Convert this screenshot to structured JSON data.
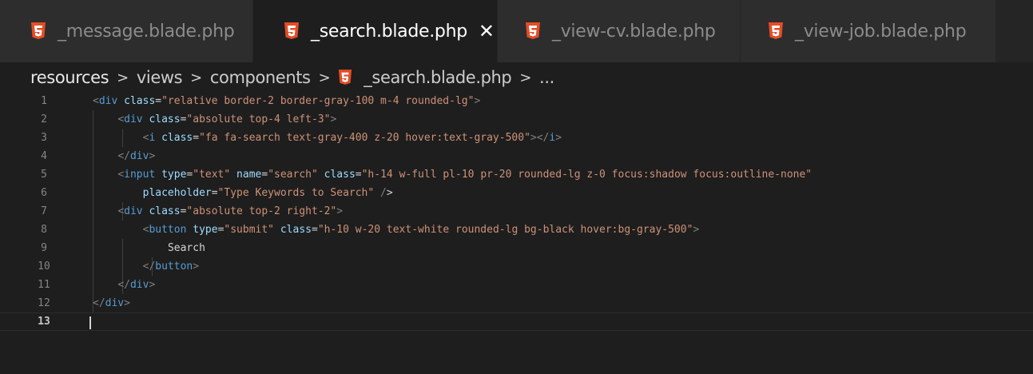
{
  "tabs": [
    {
      "label": "_message.blade.php",
      "active": false
    },
    {
      "label": "_search.blade.php",
      "active": true,
      "close": "✕"
    },
    {
      "label": "_view-cv.blade.php",
      "active": false
    },
    {
      "label": "_view-job.blade.php",
      "active": false
    }
  ],
  "breadcrumb": {
    "items": [
      "resources",
      "views",
      "components",
      "_search.blade.php",
      "..."
    ],
    "separator": ">"
  },
  "editor": {
    "current_line": 13,
    "line_numbers": [
      "1",
      "2",
      "3",
      "4",
      "5",
      "6",
      "7",
      "8",
      "9",
      "10",
      "11",
      "12",
      "13"
    ],
    "lines": [
      "<div class=\"relative border-2 border-gray-100 m-4 rounded-lg\">",
      "    <div class=\"absolute top-4 left-3\">",
      "        <i class=\"fa fa-search text-gray-400 z-20 hover:text-gray-500\"></i>",
      "    </div>",
      "    <input type=\"text\" name=\"search\" class=\"h-14 w-full pl-10 pr-20 rounded-lg z-0 focus:shadow focus:outline-none\"",
      "        placeholder=\"Type Keywords to Search\" />",
      "    <div class=\"absolute top-2 right-2\">",
      "        <button type=\"submit\" class=\"h-10 w-20 text-white rounded-lg bg-black hover:bg-gray-500\">",
      "            Search",
      "        </button>",
      "    </div>",
      "</div>",
      ""
    ]
  },
  "colors": {
    "editor_bg": "#1e1e1e",
    "tabbar_bg": "#252526",
    "inactive_tab_bg": "#2d2d2d",
    "html5_icon": "#e44d26",
    "tag": "#569cd6",
    "attribute": "#9cdcfe",
    "string": "#ce9178"
  },
  "icons": {
    "file_icon": "html5-icon",
    "close_icon": "close-icon"
  }
}
